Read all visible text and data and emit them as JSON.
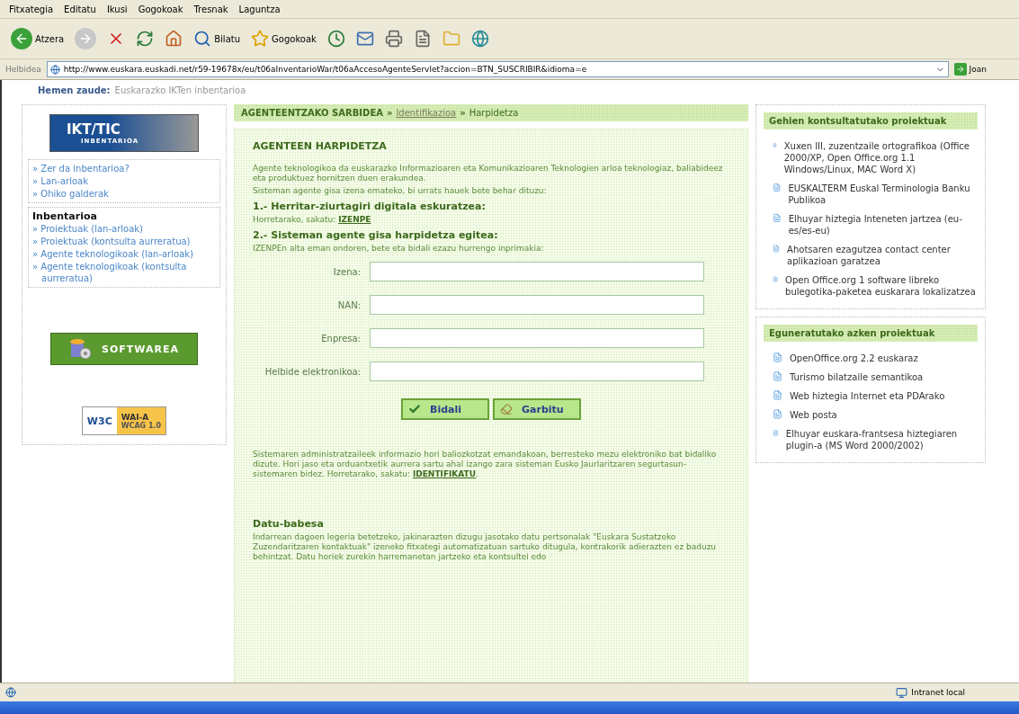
{
  "menu": [
    "Fitxategia",
    "Editatu",
    "Ikusi",
    "Gogokoak",
    "Tresnak",
    "Laguntza"
  ],
  "toolbar": {
    "back": "Atzera",
    "search": "Bilatu",
    "favorites": "Gogokoak"
  },
  "address": {
    "label": "Helbidea",
    "url": "http://www.euskara.euskadi.net/r59-19678x/eu/t06aInventarioWar/t06aAccesoAgenteServlet?accion=BTN_SUSCRIBIR&idioma=e",
    "go": "Joan"
  },
  "location": {
    "label": "Hemen zaude:",
    "text": "Euskarazko IKTen inbentarioa"
  },
  "left": {
    "logo": {
      "title": "IKT/TIC",
      "subtitle": "INBENTARIOA"
    },
    "link_bullet": "»",
    "links": [
      "Zer da inbentarioa?",
      "Lan-arloak",
      "Ohiko galderak"
    ],
    "section_title": "Inbentarioa",
    "section_links": [
      "Proiektuak (lan-arloak)",
      "Proiektuak (kontsulta aurreratua)",
      "Agente teknologikoak (lan-arloak)",
      "Agente teknologikoak (kontsulta aurreratua)"
    ],
    "software_button": "SOFTWAREA",
    "badge": {
      "w3c": "W3C",
      "level": "WAI-A",
      "standard": "WCAG 1.0"
    }
  },
  "center": {
    "path": [
      {
        "text": "AGENTEENTZAKO SARBIDEA",
        "kind": "current"
      },
      {
        "text": "Identifikazioa",
        "kind": "link"
      },
      {
        "text": "Harpidetza",
        "kind": "plain"
      }
    ],
    "path_separator": "»",
    "title": "AGENTEEN HARPIDETZA",
    "intro": "Agente teknologikoa da euskarazko Informazioaren eta Komunikazioaren Teknologien arloa teknologiaz, baliabideez eta produktuez hornitzen duen erakundea.",
    "intro2": "Sisteman agente gisa izena emateko, bi urrats hauek bete behar dituzu:",
    "step1": "1.- Herritar-ziurtagiri digitala eskuratzea:",
    "step1_text": "Horretarako, sakatu:",
    "step1_link": "IZENPE",
    "step2": "2.- Sisteman agente gisa harpidetza egitea:",
    "step2_text": "IZENPEn alta eman ondoren, bete eta bidali ezazu hurrengo inprimakia:",
    "fields": [
      "Izena:",
      "NAN:",
      "Enpresa:",
      "Helbide elektronikoa:"
    ],
    "buttons": [
      {
        "label": "Bidali",
        "kind": "send"
      },
      {
        "label": "Garbitu",
        "kind": "clear"
      }
    ],
    "after": "Sistemaren administratzaileek informazio hori baliozkotzat emandakoan, berresteko mezu elektroniko bat bidaliko dizute. Hori jaso eta orduantxetik aurrera sartu ahal izango zara sisteman Eusko Jaurlaritzaren segurtasun-sistemaren bidez. Horretarako, sakatu:",
    "after_link": "IDENTIFIKATU",
    "after_end": ".",
    "privacy_title": "Datu-babesa",
    "privacy": "Indarrean dagoen legeria betetzeko, jakinarazten dizugu jasotako datu pertsonalak \"Euskara Sustatzeko Zuzendaritzaren kontaktuak\" izeneko fitxategi automatizatuan sartuko ditugula, kontrakorik adierazten ez baduzu behintzat. Datu horiek zurekin harremanetan jartzeko eta kontsultei edo"
  },
  "right": [
    {
      "title": "Gehien kontsultatutako proiektuak",
      "items": [
        "Xuxen III, zuzentzaile ortografikoa (Office 2000/XP, Open Office.org 1.1 Windows/Linux, MAC Word X)",
        "EUSKALTERM Euskal Terminologia Banku Publikoa",
        "Elhuyar hiztegia Inteneten jartzea (eu-es/es-eu)",
        "Ahotsaren ezagutzea contact center aplikazioan garatzea",
        "Open Office.org 1 software libreko bulegotika-paketea euskarara lokalizatzea"
      ]
    },
    {
      "title": "Eguneratutako azken proiektuak",
      "items": [
        "OpenOffice.org 2.2 euskaraz",
        "Turismo bilatzaile semantikoa",
        "Web hiztegia Internet eta PDArako",
        "Web posta",
        "Elhuyar euskara-frantsesa hiztegiaren plugin-a (MS Word 2000/2002)"
      ]
    }
  ],
  "status": {
    "zone": "Intranet local"
  }
}
